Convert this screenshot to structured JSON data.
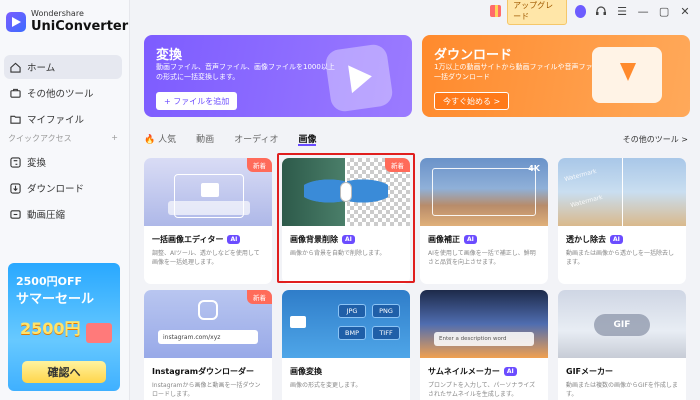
{
  "brand": {
    "sub": "Wondershare",
    "main": "UniConverter"
  },
  "nav": [
    {
      "label": "ホーム"
    },
    {
      "label": "その他のツール"
    },
    {
      "label": "マイファイル"
    }
  ],
  "quick_access": {
    "label": "クイックアクセス",
    "add": "+"
  },
  "nav2": [
    {
      "label": "変換"
    },
    {
      "label": "ダウンロード"
    },
    {
      "label": "動画圧縮"
    }
  ],
  "promo": {
    "line1": "2500円OFF",
    "line2": "サマーセール",
    "big": "2500円",
    "button": "確認へ"
  },
  "titlebar": {
    "upgrade": "アップグレード",
    "minimize": "—",
    "maximize": "▢",
    "close": "✕",
    "menu": "☰"
  },
  "banners": [
    {
      "title": "変換",
      "desc": "動画ファイル、音声ファイル、画像ファイルを1000以上の形式に一括変換します。",
      "button": "+ ファイルを追加"
    },
    {
      "title": "ダウンロード",
      "desc": "1万以上の動画サイトから動画ファイルや音声ファイルを一括ダウンロード",
      "button": "今すぐ始める >"
    }
  ],
  "tabs": [
    {
      "label": "🔥 人気"
    },
    {
      "label": "動画"
    },
    {
      "label": "オーディオ"
    },
    {
      "label": "画像"
    }
  ],
  "more_tools": "その他のツール >",
  "cards": [
    {
      "title": "一括画像エディター",
      "ai": "AI",
      "desc": "調整、AIツール、透かしなどを使用して画像を一括処理します。",
      "badge": "新着"
    },
    {
      "title": "画像背景削除",
      "ai": "AI",
      "desc": "画像から背景を自動で削除します。",
      "badge": "新着"
    },
    {
      "title": "画像補正",
      "ai": "AI",
      "desc": "AIを使用して画像を一括で補正し、鮮明さと品質を向上させます。",
      "tag": "4K"
    },
    {
      "title": "透かし除去",
      "ai": "AI",
      "desc": "動画または画像から透かしを一括除去します。",
      "wm": "Watermark"
    },
    {
      "title": "Instagramダウンローダー",
      "desc": "Instagramから画像と動画を一括ダウンロードします。",
      "badge": "新着",
      "url": "instagram.com/xyz"
    },
    {
      "title": "画像変換",
      "desc": "画像の形式を変更します。",
      "formats": [
        "JPG",
        "PNG",
        "BMP",
        "TIFF"
      ]
    },
    {
      "title": "サムネイルメーカー",
      "ai": "AI",
      "desc": "プロンプトを入力して、パーソナライズされたサムネイルを生成します。",
      "prompt": "Enter a description word"
    },
    {
      "title": "GIFメーカー",
      "desc": "動画または複数の画像からGIFを作成します。",
      "gif": "GIF"
    }
  ],
  "colors": {
    "accent": "#6b4cff",
    "highlight": "#e01e1e"
  }
}
